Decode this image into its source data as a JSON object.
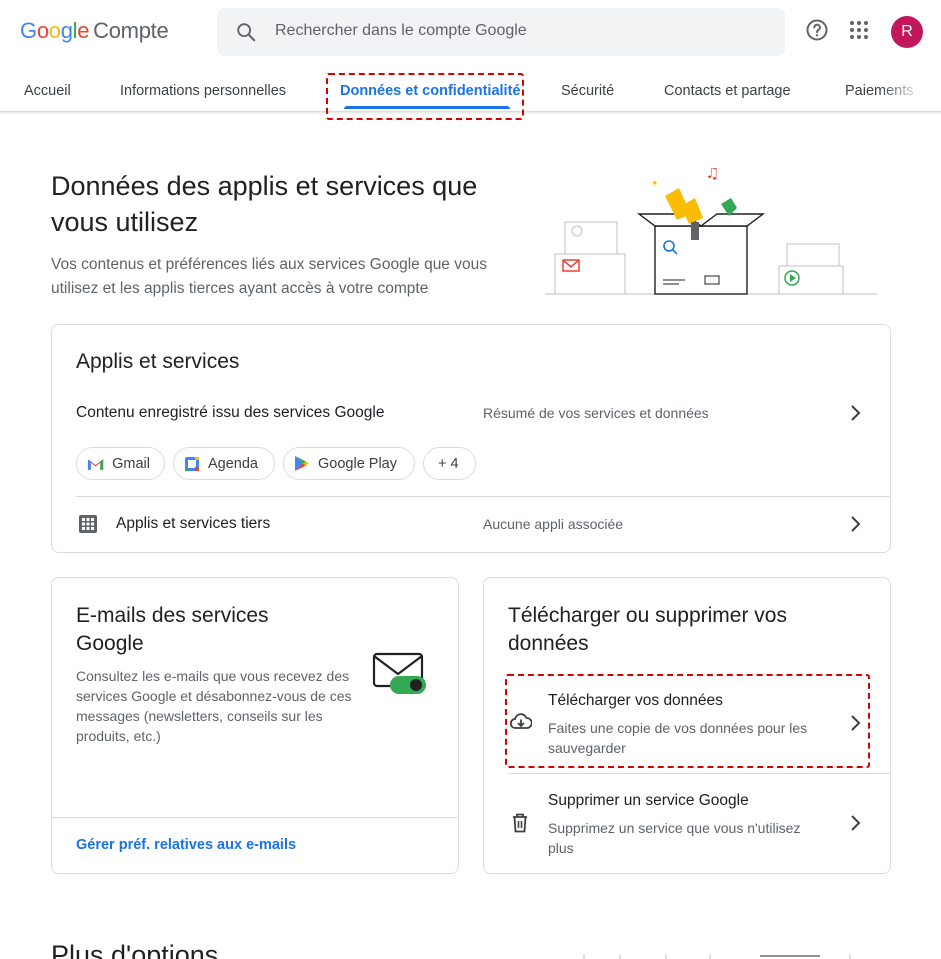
{
  "header": {
    "logo_word": "Google",
    "logo_product": "Compte",
    "search_placeholder": "Rechercher dans le compte Google",
    "avatar_letter": "R"
  },
  "tabs": [
    {
      "label": "Accueil"
    },
    {
      "label": "Informations personnelles"
    },
    {
      "label": "Données et confidentialité"
    },
    {
      "label": "Sécurité"
    },
    {
      "label": "Contacts et partage"
    },
    {
      "label": "Paiements"
    }
  ],
  "hero": {
    "title": "Données des applis et services que vous utilisez",
    "description": "Vos contenus et préférences liés aux services Google que vous utilisez et les applis tierces ayant accès à votre compte"
  },
  "apps_card": {
    "title": "Applis et services",
    "saved_content_label": "Contenu enregistré issu des services Google",
    "saved_content_summary": "Résumé de vos services et données",
    "chips": [
      "Gmail",
      "Agenda",
      "Google Play",
      "+ 4"
    ],
    "third_party_label": "Applis et services tiers",
    "third_party_summary": "Aucune appli associée"
  },
  "emails_card": {
    "title": "E-mails des services Google",
    "description": "Consultez les e-mails que vous recevez des services Google et désabonnez-vous de ces messages (newsletters, conseils sur les produits, etc.)",
    "link": "Gérer préf. relatives aux e-mails"
  },
  "download_card": {
    "title": "Télécharger ou supprimer vos données",
    "download_title": "Télécharger vos données",
    "download_desc": "Faites une copie de vos données pour les sauvegarder",
    "delete_title": "Supprimer un service Google",
    "delete_desc": "Supprimez un service que vous n'utilisez plus"
  },
  "more": {
    "title": "Plus d'options"
  },
  "colors": {
    "accent": "#1a73e8",
    "highlight": "#d50000",
    "avatar": "#c2185b",
    "toggle_on": "#34a853"
  },
  "icons": [
    "search-icon",
    "help-icon",
    "apps-grid-icon",
    "chevron-right-icon",
    "gmail-icon",
    "calendar-icon",
    "google-play-icon",
    "third-party-apps-icon",
    "cloud-download-icon",
    "trash-icon",
    "email-toggle-icon"
  ]
}
